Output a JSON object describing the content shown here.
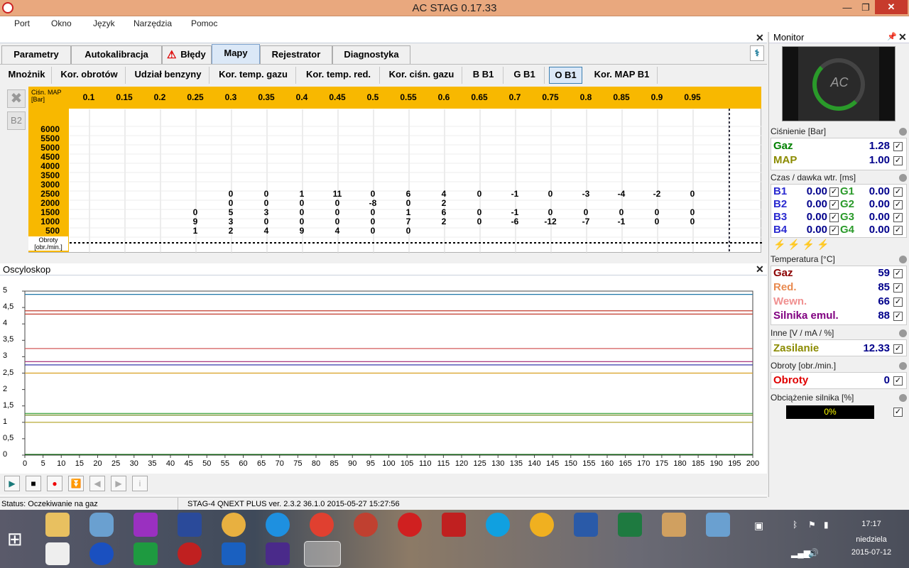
{
  "window": {
    "title": "AC STAG 0.17.33"
  },
  "menu": [
    "Port",
    "Okno",
    "Język",
    "Narzędzia",
    "Pomoc"
  ],
  "tabs": [
    "Parametry",
    "Autokalibracja",
    "Błędy",
    "Mapy",
    "Rejestrator",
    "Diagnostyka"
  ],
  "active_tab": "Mapy",
  "subtabs": [
    "Mnożnik",
    "Kor. obrotów",
    "Udział benzyny",
    "Kor. temp. gazu",
    "Kor. temp. red.",
    "Kor. ciśn. gazu",
    "B B1",
    "G B1",
    "O B1",
    "Kor. MAP B1"
  ],
  "active_subtab": "O B1",
  "map": {
    "side_button": "B2",
    "header_label": "Ciśn. MAP [Bar]",
    "footer_label": "Obroty [obr./min.]",
    "x_labels": [
      "0.1",
      "0.15",
      "0.2",
      "0.25",
      "0.3",
      "0.35",
      "0.4",
      "0.45",
      "0.5",
      "0.55",
      "0.6",
      "0.65",
      "0.7",
      "0.75",
      "0.8",
      "0.85",
      "0.9",
      "0.95"
    ],
    "y_labels": [
      "6000",
      "5500",
      "5000",
      "4500",
      "4000",
      "3500",
      "3000",
      "2500",
      "2000",
      "1500",
      "1000",
      "500"
    ],
    "rows": {
      "2500": [
        null,
        null,
        null,
        null,
        "0",
        "0",
        "1",
        "11",
        "0",
        "6",
        "4",
        "0",
        "-1",
        "0",
        "-3",
        "-4",
        "-2",
        "0"
      ],
      "2000": [
        null,
        null,
        null,
        null,
        "0",
        "0",
        "0",
        "0",
        "-8",
        "0",
        "2",
        null,
        null,
        null,
        null,
        null,
        null,
        null
      ],
      "1500": [
        null,
        null,
        null,
        "0",
        "5",
        "3",
        "0",
        "0",
        "0",
        "1",
        "6",
        "0",
        "-1",
        "0",
        "0",
        "0",
        "0",
        "0"
      ],
      "1000": [
        null,
        null,
        null,
        "9",
        "3",
        "0",
        "0",
        "0",
        "0",
        "7",
        "2",
        "0",
        "-6",
        "-12",
        "-7",
        "-1",
        "0",
        "0"
      ],
      "500": [
        null,
        null,
        null,
        "1",
        "2",
        "4",
        "9",
        "4",
        "0",
        "0",
        null,
        null,
        null,
        null,
        null,
        null,
        null,
        null
      ]
    }
  },
  "oscilloscope": {
    "title": "Oscyloskop",
    "y_ticks": [
      "5",
      "4,5",
      "4",
      "3,5",
      "3",
      "2,5",
      "2",
      "1,5",
      "1",
      "0,5",
      "0"
    ],
    "x_ticks": [
      "0",
      "5",
      "10",
      "15",
      "20",
      "25",
      "30",
      "35",
      "40",
      "45",
      "50",
      "55",
      "60",
      "65",
      "70",
      "75",
      "80",
      "85",
      "90",
      "95",
      "100",
      "105",
      "110",
      "115",
      "120",
      "125",
      "130",
      "135",
      "140",
      "145",
      "150",
      "155",
      "160",
      "165",
      "170",
      "175",
      "180",
      "185",
      "190",
      "195",
      "200"
    ],
    "traces": [
      {
        "color": "#1f77a8",
        "level": 4.9
      },
      {
        "color": "#c0392b",
        "level": 4.4
      },
      {
        "color": "#c0392b",
        "level": 4.3
      },
      {
        "color": "#d35a5a",
        "level": 3.25
      },
      {
        "color": "#a02070",
        "level": 2.85
      },
      {
        "color": "#2020a0",
        "level": 2.75
      },
      {
        "color": "#d8a020",
        "level": 2.5
      },
      {
        "color": "#2a9a2a",
        "level": 1.27
      },
      {
        "color": "#6a8a20",
        "level": 1.22
      },
      {
        "color": "#b0a020",
        "level": 1.0
      },
      {
        "color": "#006600",
        "level": 0.02
      }
    ]
  },
  "status": {
    "text": "Status: Oczekiwanie na gaz",
    "device": "STAG-4 QNEXT PLUS  ver. 2.3.2  36.1.0   2015-05-27 15:27:56"
  },
  "monitor": {
    "title": "Monitor",
    "pressure_title": "Ciśnienie [Bar]",
    "gaz_label": "Gaz",
    "gaz_val": "1.28",
    "map_label": "MAP",
    "map_val": "1.00",
    "inj_title": "Czas / dawka wtr. [ms]",
    "injectors": [
      {
        "b": "B1",
        "bv": "0.00",
        "g": "G1",
        "gv": "0.00"
      },
      {
        "b": "B2",
        "bv": "0.00",
        "g": "G2",
        "gv": "0.00"
      },
      {
        "b": "B3",
        "bv": "0.00",
        "g": "G3",
        "gv": "0.00"
      },
      {
        "b": "B4",
        "bv": "0.00",
        "g": "G4",
        "gv": "0.00"
      }
    ],
    "temp_title": "Temperatura [°C]",
    "temps": [
      {
        "label": "Gaz",
        "val": "59",
        "color": "#8b0000"
      },
      {
        "label": "Red.",
        "val": "85",
        "color": "#e88a50"
      },
      {
        "label": "Wewn.",
        "val": "66",
        "color": "#f09090"
      },
      {
        "label": "Silnika emul.",
        "val": "88",
        "color": "#800080"
      }
    ],
    "other_title": "Inne [V / mA / %]",
    "zasilanie_label": "Zasilanie",
    "zasilanie_val": "12.33",
    "rpm_title": "Obroty [obr./min.]",
    "rpm_label": "Obroty",
    "rpm_val": "0",
    "load_title": "Obciążenie silnika [%]",
    "load_val": "0%"
  },
  "clock": {
    "time": "17:17",
    "day": "niedziela",
    "date": "2015-07-12"
  }
}
